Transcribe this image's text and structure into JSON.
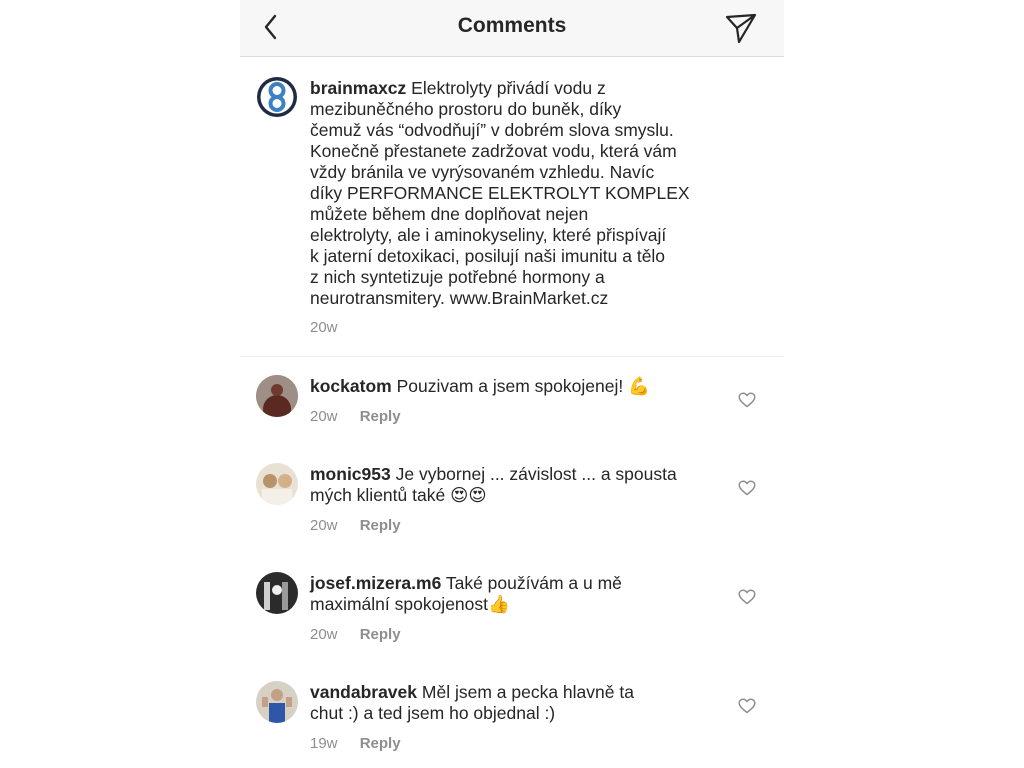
{
  "header": {
    "title": "Comments",
    "back_icon": "chevron-left-icon",
    "share_icon": "paper-plane-icon"
  },
  "caption": {
    "username": "brainmaxcz",
    "lines": [
      "Elektrolyty přivádí vodu z",
      "mezibuněčného prostoru do buněk, díky",
      "čemuž vás “odvodňují” v dobrém slova smyslu.",
      "Konečně přestanete zadržovat vodu, která vám",
      "vždy bránila ve vyrýsovaném vzhledu. Navíc",
      "díky PERFORMANCE ELEKTROLYT KOMPLEX",
      "můžete během dne doplňovat nejen",
      "elektrolyty, ale i aminokyseliny, které přispívají",
      "k jaterní detoxikaci, posilují naši imunitu a tělo",
      "z nich syntetizuje potřebné hormony a",
      "neurotransmitery. www.BrainMarket.cz"
    ],
    "time": "20w",
    "avatar_colors": {
      "ring": "#1f2a44",
      "fill": "#3b82c4"
    }
  },
  "comments": [
    {
      "username": "kockatom",
      "line1": "Pouzivam a jsem spokojenej!",
      "emoji1": "💪",
      "line2": "",
      "emoji2": "",
      "time": "20w",
      "reply": "Reply",
      "avatar_colors": {
        "bg": "#b7a7a0",
        "fg": "#5a2a22"
      }
    },
    {
      "username": "monic953",
      "line1": "Je vybornej ... závislost ... a spousta",
      "emoji1": "",
      "line2": "mých klientů také",
      "emoji2": "😍😍",
      "time": "20w",
      "reply": "Reply",
      "avatar_colors": {
        "bg": "#e9e1d4",
        "fg": "#b8926a"
      }
    },
    {
      "username": "josef.mizera.m6",
      "line1": "Také používám a u mě",
      "emoji1": "",
      "line2": "maximální spokojenost",
      "emoji2": "👍",
      "time": "20w",
      "reply": "Reply",
      "avatar_colors": {
        "bg": "#2b2b2b",
        "fg": "#cfcfcf"
      }
    },
    {
      "username": "vandabravek",
      "line1": "Měl jsem a pecka hlavně ta",
      "emoji1": "",
      "line2": "chut :) a ted jsem ho objednal :)",
      "emoji2": "",
      "time": "19w",
      "reply": "Reply",
      "avatar_colors": {
        "bg": "#d7d0c4",
        "fg": "#2f57a8"
      }
    }
  ],
  "heart_icon": "heart-outline-icon"
}
